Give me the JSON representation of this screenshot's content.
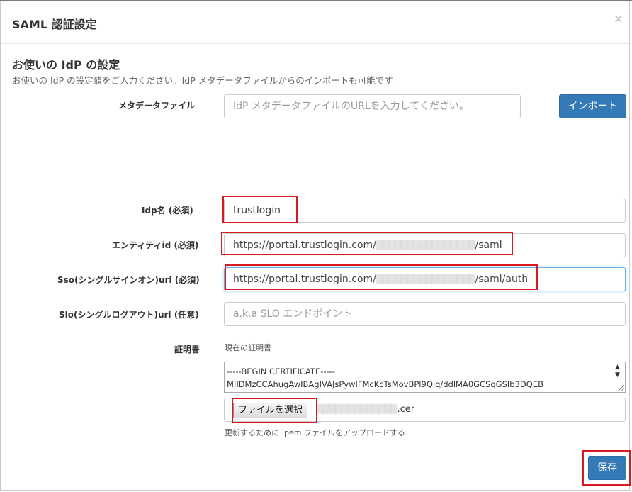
{
  "dialog": {
    "title": "SAML 認証設定",
    "close_label": "×"
  },
  "section": {
    "title": "お使いの IdP の設定",
    "description": "お使いの IdP の設定値をご入力ください。IdP メタデータファイルからのインポートも可能です。"
  },
  "metadata": {
    "label": "メタデータファイル",
    "placeholder": "IdP メタデータファイルのURLを入力してください。",
    "import_button": "インポート"
  },
  "fields": {
    "idp_name": {
      "label": "Idp名 (必須)",
      "value": "trustlogin"
    },
    "entity_id": {
      "label": "エンティティid (必須)",
      "value_prefix": "https://portal.trustlogin.com/",
      "value_masked": "▒▒▒▒▒▒▒▒▒▒▒▒▒▒▒▒",
      "value_suffix": "/saml"
    },
    "sso_url": {
      "label": "Sso(シングルサインオン)url (必須)",
      "value_prefix": "https://portal.trustlogin.com/",
      "value_masked": "▒▒▒▒▒▒▒▒▒▒▒▒▒▒▒▒",
      "value_suffix": "/saml/auth"
    },
    "slo_url": {
      "label": "Slo(シングルログアウト)url (任意)",
      "placeholder": "a.k.a SLO エンドポイント"
    }
  },
  "certificate": {
    "label": "証明書",
    "current_label": "現在の証明書",
    "lines": [
      "-----BEGIN CERTIFICATE-----",
      "MIIDMzCCAhugAwIBAgIVAJsPywIFMcKcTsMovBPl9Qlq/ddlMA0GCSqGSIb3DQEB"
    ],
    "file_button": "ファイルを選択",
    "file_name_masked": "▒▒▒▒▒▒▒▒▒▒▒▒▒",
    "file_name_suffix": ".cer",
    "help": "更新するために .pem ファイルをアップロードする"
  },
  "save_button": "保存",
  "colors": {
    "primary": "#337ab7",
    "highlight": "#d71920"
  }
}
